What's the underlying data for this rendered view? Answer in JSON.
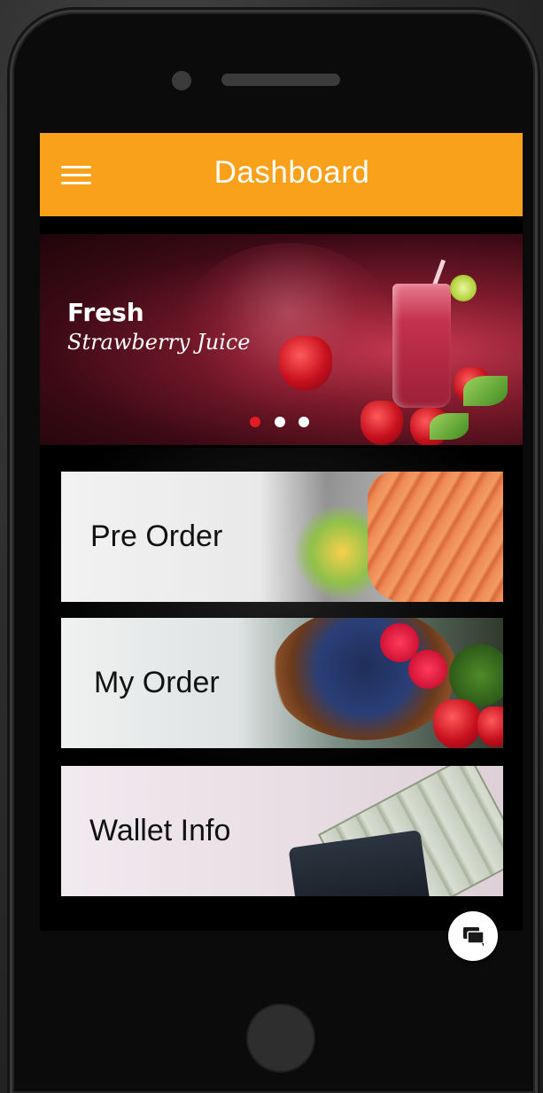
{
  "app": {
    "title": "Dashboard",
    "accent_color": "#f9a11b"
  },
  "header": {
    "menu_icon": "hamburger-menu-icon",
    "title": "Dashboard"
  },
  "banner": {
    "title": "Fresh",
    "subtitle": "Strawberry Juice",
    "carousel": {
      "total_slides": 3,
      "active_index": 0,
      "active_color": "#e41b23",
      "inactive_color": "#ffffff"
    }
  },
  "menu_cards": [
    {
      "label": "Pre Order",
      "image": "grilled-salmon-image"
    },
    {
      "label": "My Order",
      "image": "berries-bowl-image"
    },
    {
      "label": "Wallet Info",
      "image": "wallet-cash-image"
    }
  ],
  "chat_fab": {
    "icon": "chat-bubbles-icon"
  }
}
